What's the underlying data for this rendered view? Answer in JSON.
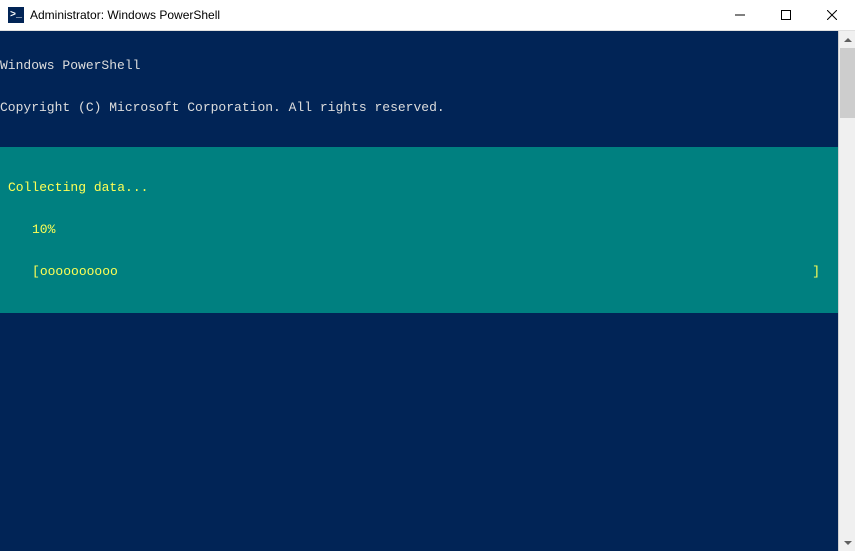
{
  "titlebar": {
    "icon_glyph": ">_",
    "title": "Administrator: Windows PowerShell"
  },
  "console": {
    "header_line1": "Windows PowerShell",
    "header_line2": "Copyright (C) Microsoft Corporation. All rights reserved."
  },
  "progress": {
    "status": "Collecting data...",
    "percent": "10%",
    "bar_open": "[",
    "bar_fill": "oooooooooo",
    "bar_close": "]"
  }
}
